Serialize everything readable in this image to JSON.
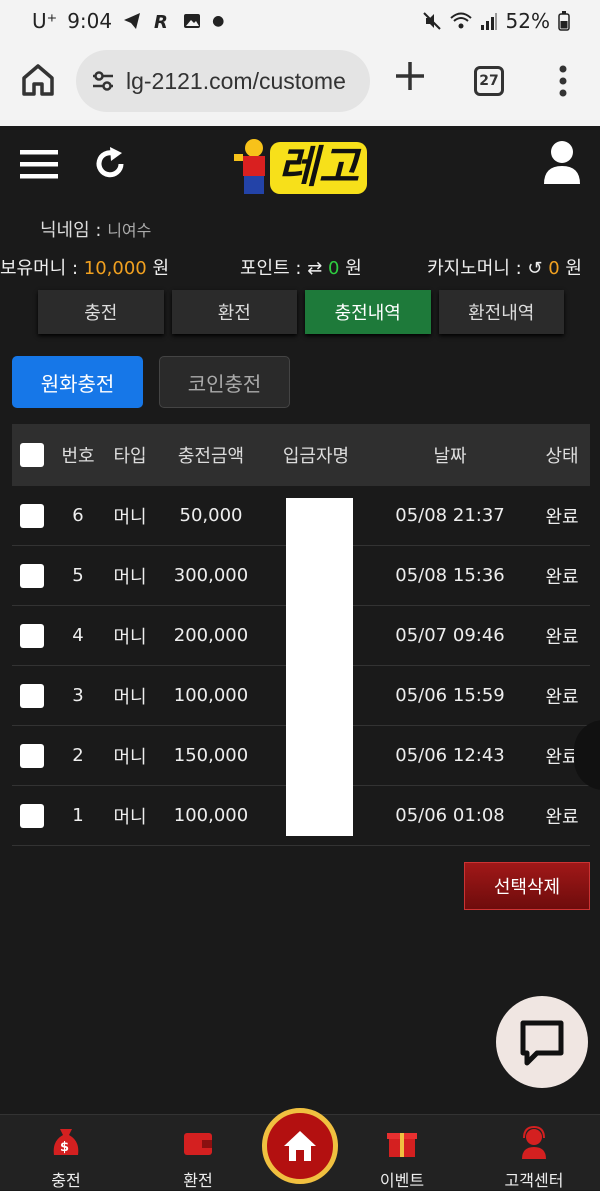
{
  "status_bar": {
    "carrier": "U⁺",
    "time": "9:04",
    "battery": "52%"
  },
  "browser": {
    "url": "lg-2121.com/custome",
    "tab_count": "27"
  },
  "header": {
    "logo_text": "레고"
  },
  "user_info": {
    "nickname_label": "닉네임 : ",
    "nickname_value": "니여수",
    "money_label": "보유머니 : ",
    "money_value": "10,000",
    "money_unit": " 원",
    "point_label": "포인트 : ",
    "point_value": "0",
    "point_unit": " 원",
    "casino_label": "카지노머니 : ",
    "casino_value": "0",
    "casino_unit": " 원"
  },
  "tabs": [
    {
      "label": "충전",
      "active": false
    },
    {
      "label": "환전",
      "active": false
    },
    {
      "label": "충전내역",
      "active": true
    },
    {
      "label": "환전내역",
      "active": false
    }
  ],
  "sub_tabs": [
    {
      "label": "원화충전",
      "active": true
    },
    {
      "label": "코인충전",
      "active": false
    }
  ],
  "table": {
    "headers": [
      "번호",
      "타입",
      "충전금액",
      "입금자명",
      "날짜",
      "상태"
    ],
    "rows": [
      {
        "num": "6",
        "type": "머니",
        "amount": "50,000",
        "date": "05/08 21:37",
        "status": "완료"
      },
      {
        "num": "5",
        "type": "머니",
        "amount": "300,000",
        "date": "05/08 15:36",
        "status": "완료"
      },
      {
        "num": "4",
        "type": "머니",
        "amount": "200,000",
        "date": "05/07 09:46",
        "status": "완료"
      },
      {
        "num": "3",
        "type": "머니",
        "amount": "100,000",
        "date": "05/06 15:59",
        "status": "완료"
      },
      {
        "num": "2",
        "type": "머니",
        "amount": "150,000",
        "date": "05/06 12:43",
        "status": "완료"
      },
      {
        "num": "1",
        "type": "머니",
        "amount": "100,000",
        "date": "05/06 01:08",
        "status": "완료"
      }
    ]
  },
  "delete_button": "선택삭제",
  "bottom_nav": [
    {
      "label": "충전"
    },
    {
      "label": "환전"
    },
    {
      "label": "이벤트"
    },
    {
      "label": "고객센터"
    }
  ],
  "colors": {
    "accent_blue": "#1677e8",
    "active_tab_green": "#1e7a3a",
    "money_orange": "#f0a020",
    "delete_red": "#a01818"
  }
}
